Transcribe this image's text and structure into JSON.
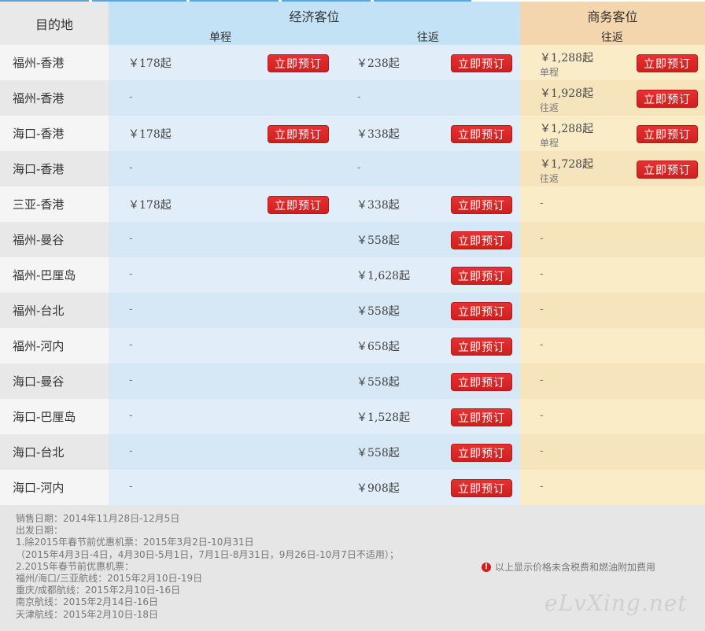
{
  "header": {
    "destination": "目的地",
    "economy": "经济客位",
    "business": "商务客位",
    "one_way": "单程",
    "round_trip": "往返",
    "biz_round_trip": "往返"
  },
  "book_label": "立即预订",
  "dash": "-",
  "rows": [
    {
      "route": "福州-香港",
      "eco_ow": "￥178起",
      "eco_rt": "￥238起",
      "biz": "￥1,288起",
      "biz_tag": "单程"
    },
    {
      "route": "福州-香港",
      "eco_ow": null,
      "eco_rt": null,
      "biz": "￥1,928起",
      "biz_tag": "往返"
    },
    {
      "route": "海口-香港",
      "eco_ow": "￥178起",
      "eco_rt": "￥338起",
      "biz": "￥1,288起",
      "biz_tag": "单程"
    },
    {
      "route": "海口-香港",
      "eco_ow": null,
      "eco_rt": null,
      "biz": "￥1,728起",
      "biz_tag": "往返"
    },
    {
      "route": "三亚-香港",
      "eco_ow": "￥178起",
      "eco_rt": "￥338起",
      "biz": null,
      "biz_tag": null
    },
    {
      "route": "福州-曼谷",
      "eco_ow": null,
      "eco_rt": "￥558起",
      "biz": null,
      "biz_tag": null
    },
    {
      "route": "福州-巴厘岛",
      "eco_ow": null,
      "eco_rt": "￥1,628起",
      "biz": null,
      "biz_tag": null
    },
    {
      "route": "福州-台北",
      "eco_ow": null,
      "eco_rt": "￥558起",
      "biz": null,
      "biz_tag": null
    },
    {
      "route": "福州-河内",
      "eco_ow": null,
      "eco_rt": "￥658起",
      "biz": null,
      "biz_tag": null
    },
    {
      "route": "海口-曼谷",
      "eco_ow": null,
      "eco_rt": "￥558起",
      "biz": null,
      "biz_tag": null
    },
    {
      "route": "海口-巴厘岛",
      "eco_ow": null,
      "eco_rt": "￥1,528起",
      "biz": null,
      "biz_tag": null
    },
    {
      "route": "海口-台北",
      "eco_ow": null,
      "eco_rt": "￥558起",
      "biz": null,
      "biz_tag": null
    },
    {
      "route": "海口-河内",
      "eco_ow": null,
      "eco_rt": "￥908起",
      "biz": null,
      "biz_tag": null
    }
  ],
  "notes": [
    "销售日期：2014年11月28日-12月5日",
    "出发日期：",
    "1.除2015年春节前优惠机票：2015年3月2日-10月31日",
    "（2015年4月3日-4日，4月30日-5月1日，7月1日-8月31日，9月26日-10月7日不适用）；",
    "2.2015年春节前优惠机票：",
    "福州/海口/三亚航线：2015年2月10日-19日",
    "重庆/成都航线：2015年2月10日-16日",
    "南京航线：2015年2月14日-16日",
    "天津航线：2015年2月10日-18日"
  ],
  "notice": "以上显示价格未含税费和燃油附加费用",
  "notice_icon": "warning-icon",
  "watermark": "eLvXing.net",
  "colors": {
    "economy_header": "#c4e2f5",
    "business_header": "#f4d6ae",
    "button": "#d92525"
  }
}
